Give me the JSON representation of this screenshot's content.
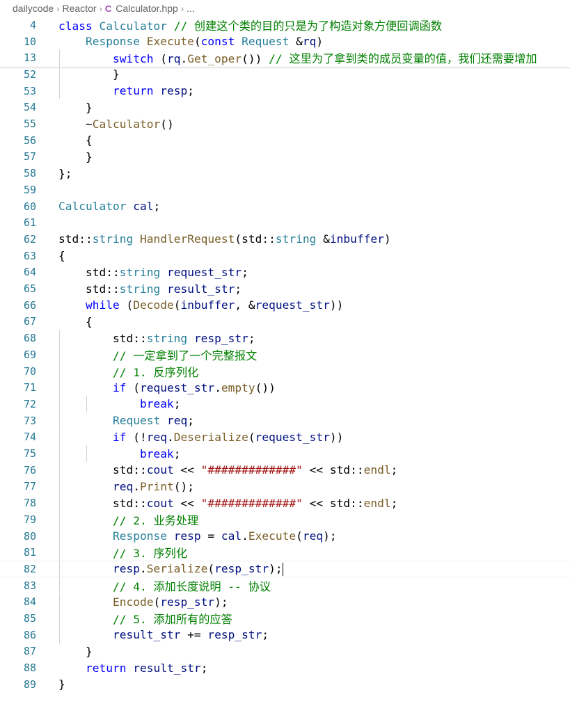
{
  "breadcrumb": {
    "items": [
      "dailycode",
      "Reactor",
      "Calculator.hpp",
      "..."
    ]
  },
  "editor": {
    "lines": [
      {
        "n": "4",
        "tokens": [
          [
            "k",
            "class "
          ],
          [
            "t",
            "Calculator"
          ],
          [
            "c",
            " // 创建这个类的目的只是为了构造对象方便回调函数"
          ]
        ]
      },
      {
        "n": "10",
        "tokens": [
          [
            "n",
            "    "
          ],
          [
            "t",
            "Response"
          ],
          [
            "n",
            " "
          ],
          [
            "f",
            "Execute"
          ],
          [
            "n",
            "("
          ],
          [
            "k",
            "const"
          ],
          [
            "n",
            " "
          ],
          [
            "t",
            "Request"
          ],
          [
            "n",
            " &"
          ],
          [
            "v",
            "rq"
          ],
          [
            "n",
            ")"
          ]
        ]
      },
      {
        "n": "13",
        "tokens": [
          [
            "n",
            "        "
          ],
          [
            "k",
            "switch"
          ],
          [
            "n",
            " ("
          ],
          [
            "v",
            "rq"
          ],
          [
            "n",
            "."
          ],
          [
            "f",
            "Get_oper"
          ],
          [
            "n",
            "()) "
          ],
          [
            "c",
            "// 这里为了拿到类的成员变量的值，我们还需要增加"
          ]
        ]
      },
      {
        "n": "52",
        "tokens": [
          [
            "n",
            "        }"
          ]
        ]
      },
      {
        "n": "53",
        "tokens": [
          [
            "n",
            "        "
          ],
          [
            "k",
            "return"
          ],
          [
            "n",
            " "
          ],
          [
            "v",
            "resp"
          ],
          [
            "n",
            ";"
          ]
        ]
      },
      {
        "n": "54",
        "tokens": [
          [
            "n",
            "    }"
          ]
        ]
      },
      {
        "n": "55",
        "tokens": [
          [
            "n",
            "    ~"
          ],
          [
            "f",
            "Calculator"
          ],
          [
            "n",
            "()"
          ]
        ]
      },
      {
        "n": "56",
        "tokens": [
          [
            "n",
            "    {"
          ]
        ]
      },
      {
        "n": "57",
        "tokens": [
          [
            "n",
            "    }"
          ]
        ]
      },
      {
        "n": "58",
        "tokens": [
          [
            "n",
            "};"
          ]
        ]
      },
      {
        "n": "59",
        "tokens": []
      },
      {
        "n": "60",
        "tokens": [
          [
            "t",
            "Calculator"
          ],
          [
            "n",
            " "
          ],
          [
            "v",
            "cal"
          ],
          [
            "n",
            ";"
          ]
        ]
      },
      {
        "n": "61",
        "tokens": []
      },
      {
        "n": "62",
        "tokens": [
          [
            "n",
            "std::"
          ],
          [
            "t",
            "string"
          ],
          [
            "n",
            " "
          ],
          [
            "f",
            "HandlerRequest"
          ],
          [
            "n",
            "(std::"
          ],
          [
            "t",
            "string"
          ],
          [
            "n",
            " &"
          ],
          [
            "v",
            "inbuffer"
          ],
          [
            "n",
            ")"
          ]
        ]
      },
      {
        "n": "63",
        "tokens": [
          [
            "n",
            "{"
          ]
        ]
      },
      {
        "n": "64",
        "tokens": [
          [
            "n",
            "    std::"
          ],
          [
            "t",
            "string"
          ],
          [
            "n",
            " "
          ],
          [
            "v",
            "request_str"
          ],
          [
            "n",
            ";"
          ]
        ]
      },
      {
        "n": "65",
        "tokens": [
          [
            "n",
            "    std::"
          ],
          [
            "t",
            "string"
          ],
          [
            "n",
            " "
          ],
          [
            "v",
            "result_str"
          ],
          [
            "n",
            ";"
          ]
        ]
      },
      {
        "n": "66",
        "tokens": [
          [
            "n",
            "    "
          ],
          [
            "k",
            "while"
          ],
          [
            "n",
            " ("
          ],
          [
            "f",
            "Decode"
          ],
          [
            "n",
            "("
          ],
          [
            "v",
            "inbuffer"
          ],
          [
            "n",
            ", &"
          ],
          [
            "v",
            "request_str"
          ],
          [
            "n",
            "))"
          ]
        ]
      },
      {
        "n": "67",
        "tokens": [
          [
            "n",
            "    {"
          ]
        ]
      },
      {
        "n": "68",
        "tokens": [
          [
            "n",
            "        std::"
          ],
          [
            "t",
            "string"
          ],
          [
            "n",
            " "
          ],
          [
            "v",
            "resp_str"
          ],
          [
            "n",
            ";"
          ]
        ]
      },
      {
        "n": "69",
        "tokens": [
          [
            "n",
            "        "
          ],
          [
            "c",
            "// 一定拿到了一个完整报文"
          ]
        ]
      },
      {
        "n": "70",
        "tokens": [
          [
            "n",
            "        "
          ],
          [
            "c",
            "// 1. 反序列化"
          ]
        ]
      },
      {
        "n": "71",
        "tokens": [
          [
            "n",
            "        "
          ],
          [
            "k",
            "if"
          ],
          [
            "n",
            " ("
          ],
          [
            "v",
            "request_str"
          ],
          [
            "n",
            "."
          ],
          [
            "f",
            "empty"
          ],
          [
            "n",
            "())"
          ]
        ]
      },
      {
        "n": "72",
        "tokens": [
          [
            "n",
            "            "
          ],
          [
            "k",
            "break"
          ],
          [
            "n",
            ";"
          ]
        ]
      },
      {
        "n": "73",
        "tokens": [
          [
            "n",
            "        "
          ],
          [
            "t",
            "Request"
          ],
          [
            "n",
            " "
          ],
          [
            "v",
            "req"
          ],
          [
            "n",
            ";"
          ]
        ]
      },
      {
        "n": "74",
        "tokens": [
          [
            "n",
            "        "
          ],
          [
            "k",
            "if"
          ],
          [
            "n",
            " (!"
          ],
          [
            "v",
            "req"
          ],
          [
            "n",
            "."
          ],
          [
            "f",
            "Deserialize"
          ],
          [
            "n",
            "("
          ],
          [
            "v",
            "request_str"
          ],
          [
            "n",
            "))"
          ]
        ]
      },
      {
        "n": "75",
        "tokens": [
          [
            "n",
            "            "
          ],
          [
            "k",
            "break"
          ],
          [
            "n",
            ";"
          ]
        ]
      },
      {
        "n": "76",
        "tokens": [
          [
            "n",
            "        std::"
          ],
          [
            "v",
            "cout"
          ],
          [
            "n",
            " << "
          ],
          [
            "s",
            "\"#############\""
          ],
          [
            "n",
            " << std::"
          ],
          [
            "f",
            "endl"
          ],
          [
            "n",
            ";"
          ]
        ]
      },
      {
        "n": "77",
        "tokens": [
          [
            "n",
            "        "
          ],
          [
            "v",
            "req"
          ],
          [
            "n",
            "."
          ],
          [
            "f",
            "Print"
          ],
          [
            "n",
            "();"
          ]
        ]
      },
      {
        "n": "78",
        "tokens": [
          [
            "n",
            "        std::"
          ],
          [
            "v",
            "cout"
          ],
          [
            "n",
            " << "
          ],
          [
            "s",
            "\"#############\""
          ],
          [
            "n",
            " << std::"
          ],
          [
            "f",
            "endl"
          ],
          [
            "n",
            ";"
          ]
        ]
      },
      {
        "n": "79",
        "tokens": [
          [
            "n",
            "        "
          ],
          [
            "c",
            "// 2. 业务处理"
          ]
        ]
      },
      {
        "n": "80",
        "tokens": [
          [
            "n",
            "        "
          ],
          [
            "t",
            "Response"
          ],
          [
            "n",
            " "
          ],
          [
            "v",
            "resp"
          ],
          [
            "n",
            " = "
          ],
          [
            "v",
            "cal"
          ],
          [
            "n",
            "."
          ],
          [
            "f",
            "Execute"
          ],
          [
            "n",
            "("
          ],
          [
            "v",
            "req"
          ],
          [
            "n",
            ");"
          ]
        ]
      },
      {
        "n": "81",
        "tokens": [
          [
            "n",
            "        "
          ],
          [
            "c",
            "// 3. 序列化"
          ]
        ]
      },
      {
        "n": "82",
        "tokens": [
          [
            "n",
            "        "
          ],
          [
            "v",
            "resp"
          ],
          [
            "n",
            "."
          ],
          [
            "f",
            "Serialize"
          ],
          [
            "n",
            "("
          ],
          [
            "v",
            "resp_str"
          ],
          [
            "n",
            ");"
          ]
        ]
      },
      {
        "n": "83",
        "tokens": [
          [
            "n",
            "        "
          ],
          [
            "c",
            "// 4. 添加长度说明 -- 协议"
          ]
        ]
      },
      {
        "n": "84",
        "tokens": [
          [
            "n",
            "        "
          ],
          [
            "f",
            "Encode"
          ],
          [
            "n",
            "("
          ],
          [
            "v",
            "resp_str"
          ],
          [
            "n",
            ");"
          ]
        ]
      },
      {
        "n": "85",
        "tokens": [
          [
            "n",
            "        "
          ],
          [
            "c",
            "// 5. 添加所有的应答"
          ]
        ]
      },
      {
        "n": "86",
        "tokens": [
          [
            "n",
            "        "
          ],
          [
            "v",
            "result_str"
          ],
          [
            "n",
            " += "
          ],
          [
            "v",
            "resp_str"
          ],
          [
            "n",
            ";"
          ]
        ]
      },
      {
        "n": "87",
        "tokens": [
          [
            "n",
            "    }"
          ]
        ]
      },
      {
        "n": "88",
        "tokens": [
          [
            "n",
            "    "
          ],
          [
            "k",
            "return"
          ],
          [
            "n",
            " "
          ],
          [
            "v",
            "result_str"
          ],
          [
            "n",
            ";"
          ]
        ]
      },
      {
        "n": "89",
        "tokens": [
          [
            "n",
            "}"
          ]
        ]
      }
    ]
  }
}
